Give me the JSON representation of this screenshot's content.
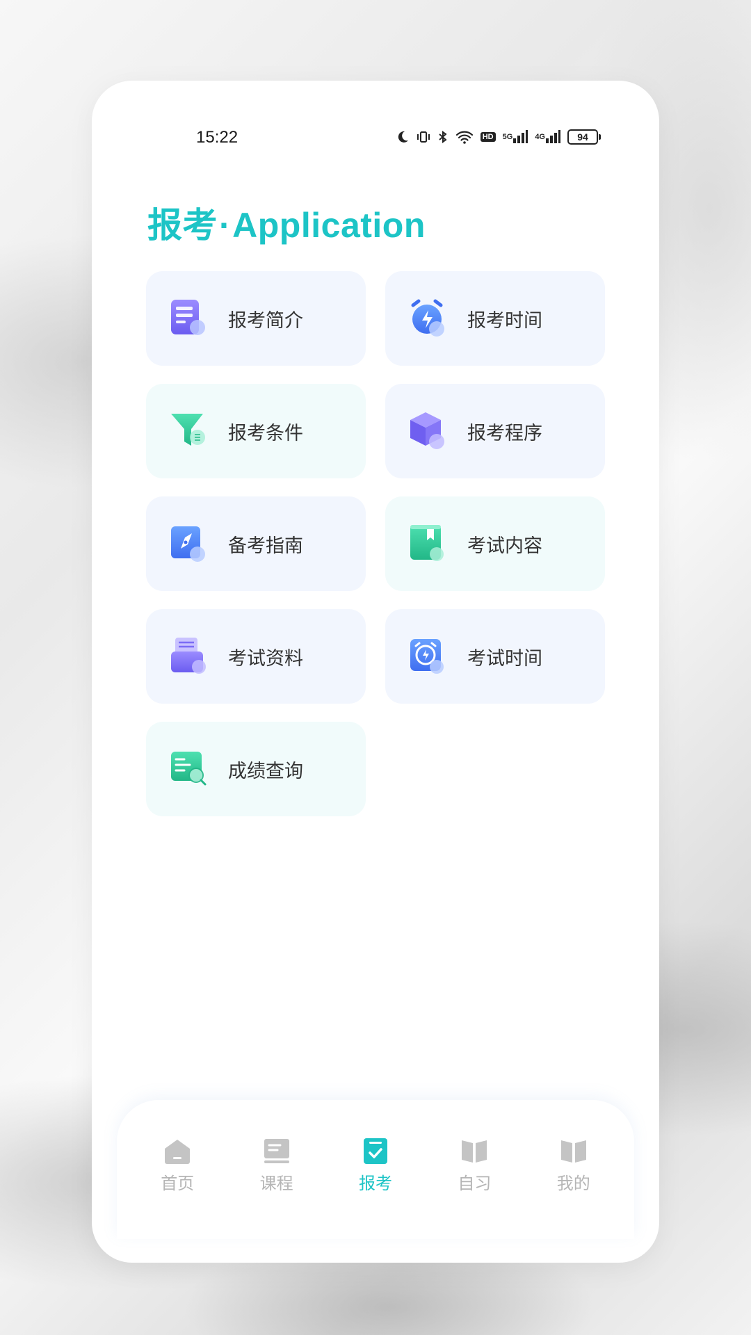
{
  "status_bar": {
    "time": "15:22",
    "hd": "HD",
    "net1": "5G",
    "net2": "4G",
    "battery": "94"
  },
  "header": {
    "title_cn": "报考",
    "title_dot": "·",
    "title_en": "Application"
  },
  "menu": {
    "items": [
      {
        "label": "报考简介",
        "icon": "document-icon",
        "color": "#7b6cf6"
      },
      {
        "label": "报考时间",
        "icon": "alarm-clock-icon",
        "color": "#4f7ff5"
      },
      {
        "label": "报考条件",
        "icon": "funnel-icon",
        "color": "#2ec79a"
      },
      {
        "label": "报考程序",
        "icon": "cube-icon",
        "color": "#7b6cf6"
      },
      {
        "label": "备考指南",
        "icon": "compass-icon",
        "color": "#4f7ff5"
      },
      {
        "label": "考试内容",
        "icon": "book-icon",
        "color": "#2ec79a"
      },
      {
        "label": "考试资料",
        "icon": "folder-stack-icon",
        "color": "#7b6cf6"
      },
      {
        "label": "考试时间",
        "icon": "alarm-square-icon",
        "color": "#4f7ff5"
      },
      {
        "label": "成绩查询",
        "icon": "search-list-icon",
        "color": "#2ec79a"
      }
    ]
  },
  "tabbar": {
    "items": [
      {
        "label": "首页",
        "icon": "home-icon"
      },
      {
        "label": "课程",
        "icon": "course-icon"
      },
      {
        "label": "报考",
        "icon": "exam-check-icon",
        "active": true
      },
      {
        "label": "自习",
        "icon": "open-book-icon"
      },
      {
        "label": "我的",
        "icon": "profile-book-icon"
      }
    ]
  },
  "colors": {
    "accent": "#1dc4c6",
    "card_blue": "#f2f6fe",
    "card_teal": "#f1fbfb",
    "inactive_tab": "#b5b5b5"
  }
}
